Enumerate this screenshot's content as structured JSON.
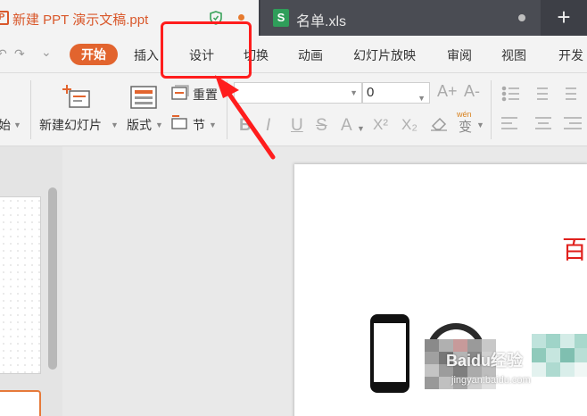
{
  "tabs": {
    "active": {
      "title": "新建 PPT 演示文稿.ppt",
      "icon": "ppt-icon"
    },
    "other": {
      "title": "名单.xls",
      "icon": "s-icon",
      "icon_letter": "S"
    },
    "new_tab_label": "+"
  },
  "quick_access": {
    "undo": "↶",
    "redo": "↷",
    "more": "⌄"
  },
  "menu": {
    "start": "开始",
    "items": [
      "插入",
      "设计",
      "切换",
      "动画",
      "幻灯片放映",
      "审阅",
      "视图",
      "开发"
    ]
  },
  "ribbon": {
    "partial_left": "始",
    "new_slide": "新建幻灯片",
    "layout": "版式",
    "reset": "重置",
    "section": "节",
    "font_name": "",
    "font_size": "0",
    "grow_font": "A+",
    "shrink_font": "A-",
    "format_buttons": [
      "B",
      "I",
      "U",
      "S",
      "A",
      "X²",
      "X₂"
    ],
    "wen_label": "wén",
    "wen_char": "变"
  },
  "slide": {
    "title_partial": "百"
  },
  "watermark": {
    "main": "Baidu经验",
    "sub": "jingyan.baidu.com"
  },
  "colors": {
    "accent": "#e2642e",
    "tab_title": "#d9582b",
    "annotation": "#ff1d1d",
    "xls_icon": "#2f9e5a"
  }
}
